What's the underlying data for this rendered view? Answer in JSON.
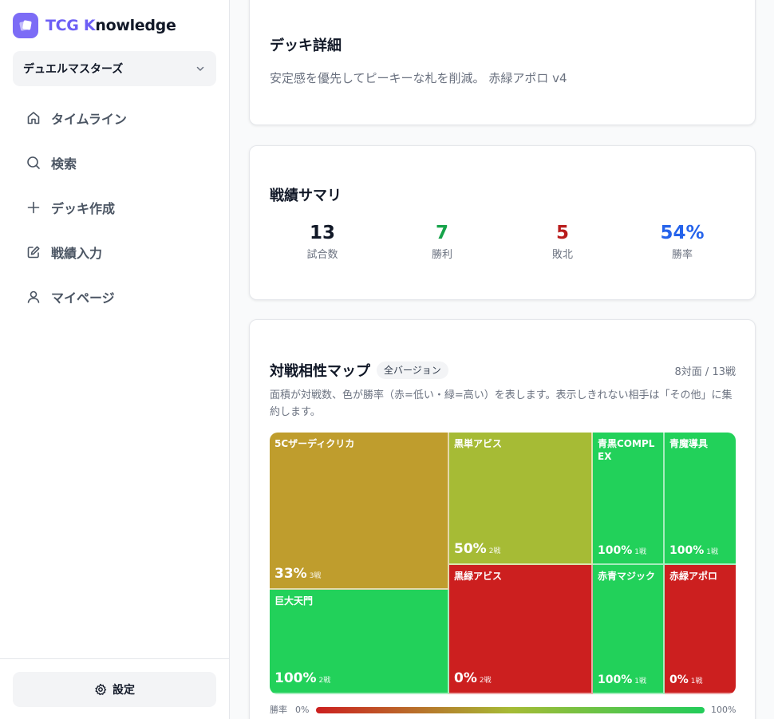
{
  "app": {
    "brand_part1": "TCG K",
    "brand_part2": "nowledge",
    "logo_icon": "cards-icon",
    "accent": "#6d5ff5"
  },
  "sidebar": {
    "game_select": {
      "value": "デュエルマスターズ"
    },
    "items": [
      {
        "label": "タイムライン",
        "icon": "home-icon"
      },
      {
        "label": "検索",
        "icon": "search-icon"
      },
      {
        "label": "デッキ作成",
        "icon": "plus-icon"
      },
      {
        "label": "戦績入力",
        "icon": "edit-icon"
      },
      {
        "label": "マイページ",
        "icon": "user-icon"
      }
    ],
    "settings_label": "設定"
  },
  "deck": {
    "title": "デッキ詳細",
    "description": "安定感を優先してピーキーな札を削減。 赤緑アポロ v4"
  },
  "summary": {
    "title": "戦績サマリ",
    "stats": [
      {
        "value": "13",
        "label": "試合数",
        "color": "#111827"
      },
      {
        "value": "7",
        "label": "勝利",
        "color": "#16a34a"
      },
      {
        "value": "5",
        "label": "敗北",
        "color": "#b91c1c"
      },
      {
        "value": "54%",
        "label": "勝率",
        "color": "#2563eb"
      }
    ]
  },
  "matchup": {
    "title": "対戦相性マップ",
    "badge": "全バージョン",
    "count": "8対面 / 13戦",
    "description": "面積が対戦数、色が勝率（赤=低い・緑=高い）を表します。表示しきれない相手は「その他」に集約します。",
    "cells": [
      {
        "name": "5Cザーディクリカ",
        "pct": "33%",
        "games": "3戦",
        "color": "#bf9d2d"
      },
      {
        "name": "巨大天門",
        "pct": "100%",
        "games": "2戦",
        "color": "#22d15a"
      },
      {
        "name": "黒単アビス",
        "pct": "50%",
        "games": "2戦",
        "color": "#a6bb35"
      },
      {
        "name": "黒緑アビス",
        "pct": "0%",
        "games": "2戦",
        "color": "#cc1f1f"
      },
      {
        "name": "青黒COMPLEX",
        "pct": "100%",
        "games": "1戦",
        "color": "#22d15a"
      },
      {
        "name": "青魔導具",
        "pct": "100%",
        "games": "1戦",
        "color": "#22d15a"
      },
      {
        "name": "赤青マジック",
        "pct": "100%",
        "games": "1戦",
        "color": "#22d15a"
      },
      {
        "name": "赤緑アポロ",
        "pct": "0%",
        "games": "1戦",
        "color": "#cc1f1f"
      }
    ],
    "legend": {
      "label": "勝率",
      "min": "0%",
      "max": "100%"
    }
  }
}
